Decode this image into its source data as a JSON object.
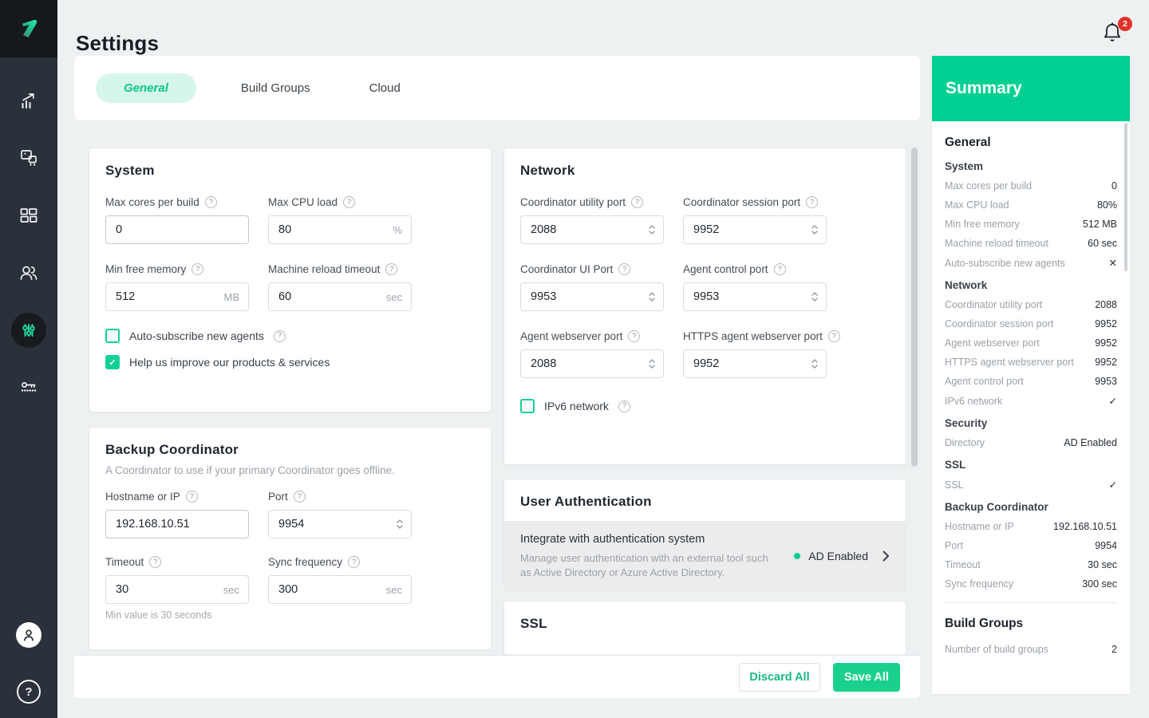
{
  "header": {
    "title": "Settings",
    "notification_count": "2"
  },
  "glyphs": {
    "help": "?",
    "check": "✓"
  },
  "tabs": [
    {
      "label": "General"
    },
    {
      "label": "Build Groups"
    },
    {
      "label": "Cloud"
    }
  ],
  "system": {
    "title": "System",
    "fields": [
      {
        "label": "Max cores per build",
        "value": "0",
        "suffix": ""
      },
      {
        "label": "Max CPU load",
        "value": "80",
        "suffix": "%"
      },
      {
        "label": "Min free memory",
        "value": "512",
        "suffix": "MB"
      },
      {
        "label": "Machine reload timeout",
        "value": "60",
        "suffix": "sec"
      }
    ],
    "checkboxes": [
      {
        "label": "Auto-subscribe new agents",
        "checked": false
      },
      {
        "label": "Help us improve our products & services",
        "checked": true
      }
    ]
  },
  "backup": {
    "title": "Backup Coordinator",
    "description": "A Coordinator to use if your primary Coordinator goes offline.",
    "fields": [
      {
        "label": "Hostname or IP",
        "value": "192.168.10.51"
      },
      {
        "label": "Port",
        "value": "9954"
      },
      {
        "label": "Timeout",
        "value": "30",
        "suffix": "sec"
      },
      {
        "label": "Sync frequency",
        "value": "300",
        "suffix": "sec"
      }
    ],
    "note": "Min value is 30 seconds"
  },
  "network": {
    "title": "Network",
    "fields": [
      {
        "label": "Coordinator utility port",
        "value": "2088"
      },
      {
        "label": "Coordinator session port",
        "value": "9952"
      },
      {
        "label": "Coordinator UI Port",
        "value": "9953"
      },
      {
        "label": "Agent control port",
        "value": "9953"
      },
      {
        "label": "Agent webserver port",
        "value": "2088"
      },
      {
        "label": "HTTPS agent webserver port",
        "value": "9952"
      }
    ],
    "checkbox": {
      "label": "IPv6 network",
      "checked": false
    }
  },
  "auth": {
    "title": "User Authentication",
    "row_title": "Integrate with authentication system",
    "row_description": "Manage user authentication with an external tool such as Active Directory or Azure Active Directory.",
    "status": "AD Enabled"
  },
  "ssl": {
    "title": "SSL"
  },
  "footer": {
    "discard_label": "Discard All",
    "save_label": "Save All"
  },
  "summary": {
    "title": "Summary",
    "general_heading": "General",
    "sections": [
      {
        "title": "System",
        "rows": [
          {
            "label": "Max cores per build",
            "value": "0"
          },
          {
            "label": "Max CPU load",
            "value": "80%"
          },
          {
            "label": "Min free memory",
            "value": "512 MB"
          },
          {
            "label": "Machine reload timeout",
            "value": "60 sec"
          },
          {
            "label": "Auto-subscribe new agents",
            "value": "✕"
          }
        ]
      },
      {
        "title": "Network",
        "rows": [
          {
            "label": "Coordinator utility port",
            "value": "2088"
          },
          {
            "label": "Coordinator session port",
            "value": "9952"
          },
          {
            "label": "Agent webserver port",
            "value": "9952"
          },
          {
            "label": "HTTPS agent webserver port",
            "value": "9952"
          },
          {
            "label": "Agent control port",
            "value": "9953"
          },
          {
            "label": "IPv6 network",
            "value": "✓"
          }
        ]
      },
      {
        "title": "Security",
        "rows": [
          {
            "label": "Directory",
            "value": "AD Enabled"
          }
        ]
      },
      {
        "title": "SSL",
        "rows": [
          {
            "label": "SSL",
            "value": "✓"
          }
        ]
      },
      {
        "title": "Backup Coordinator",
        "rows": [
          {
            "label": "Hostname or IP",
            "value": "192.168.10.51"
          },
          {
            "label": "Port",
            "value": "9954"
          },
          {
            "label": "Timeout",
            "value": "30 sec"
          },
          {
            "label": "Sync frequency",
            "value": "300 sec"
          }
        ]
      }
    ],
    "build_groups_heading": "Build Groups",
    "build_groups_rows": [
      {
        "label": "Number of build groups",
        "value": "2"
      }
    ]
  },
  "colors": {
    "accent": "#00cf92",
    "badge": "#e23127"
  }
}
